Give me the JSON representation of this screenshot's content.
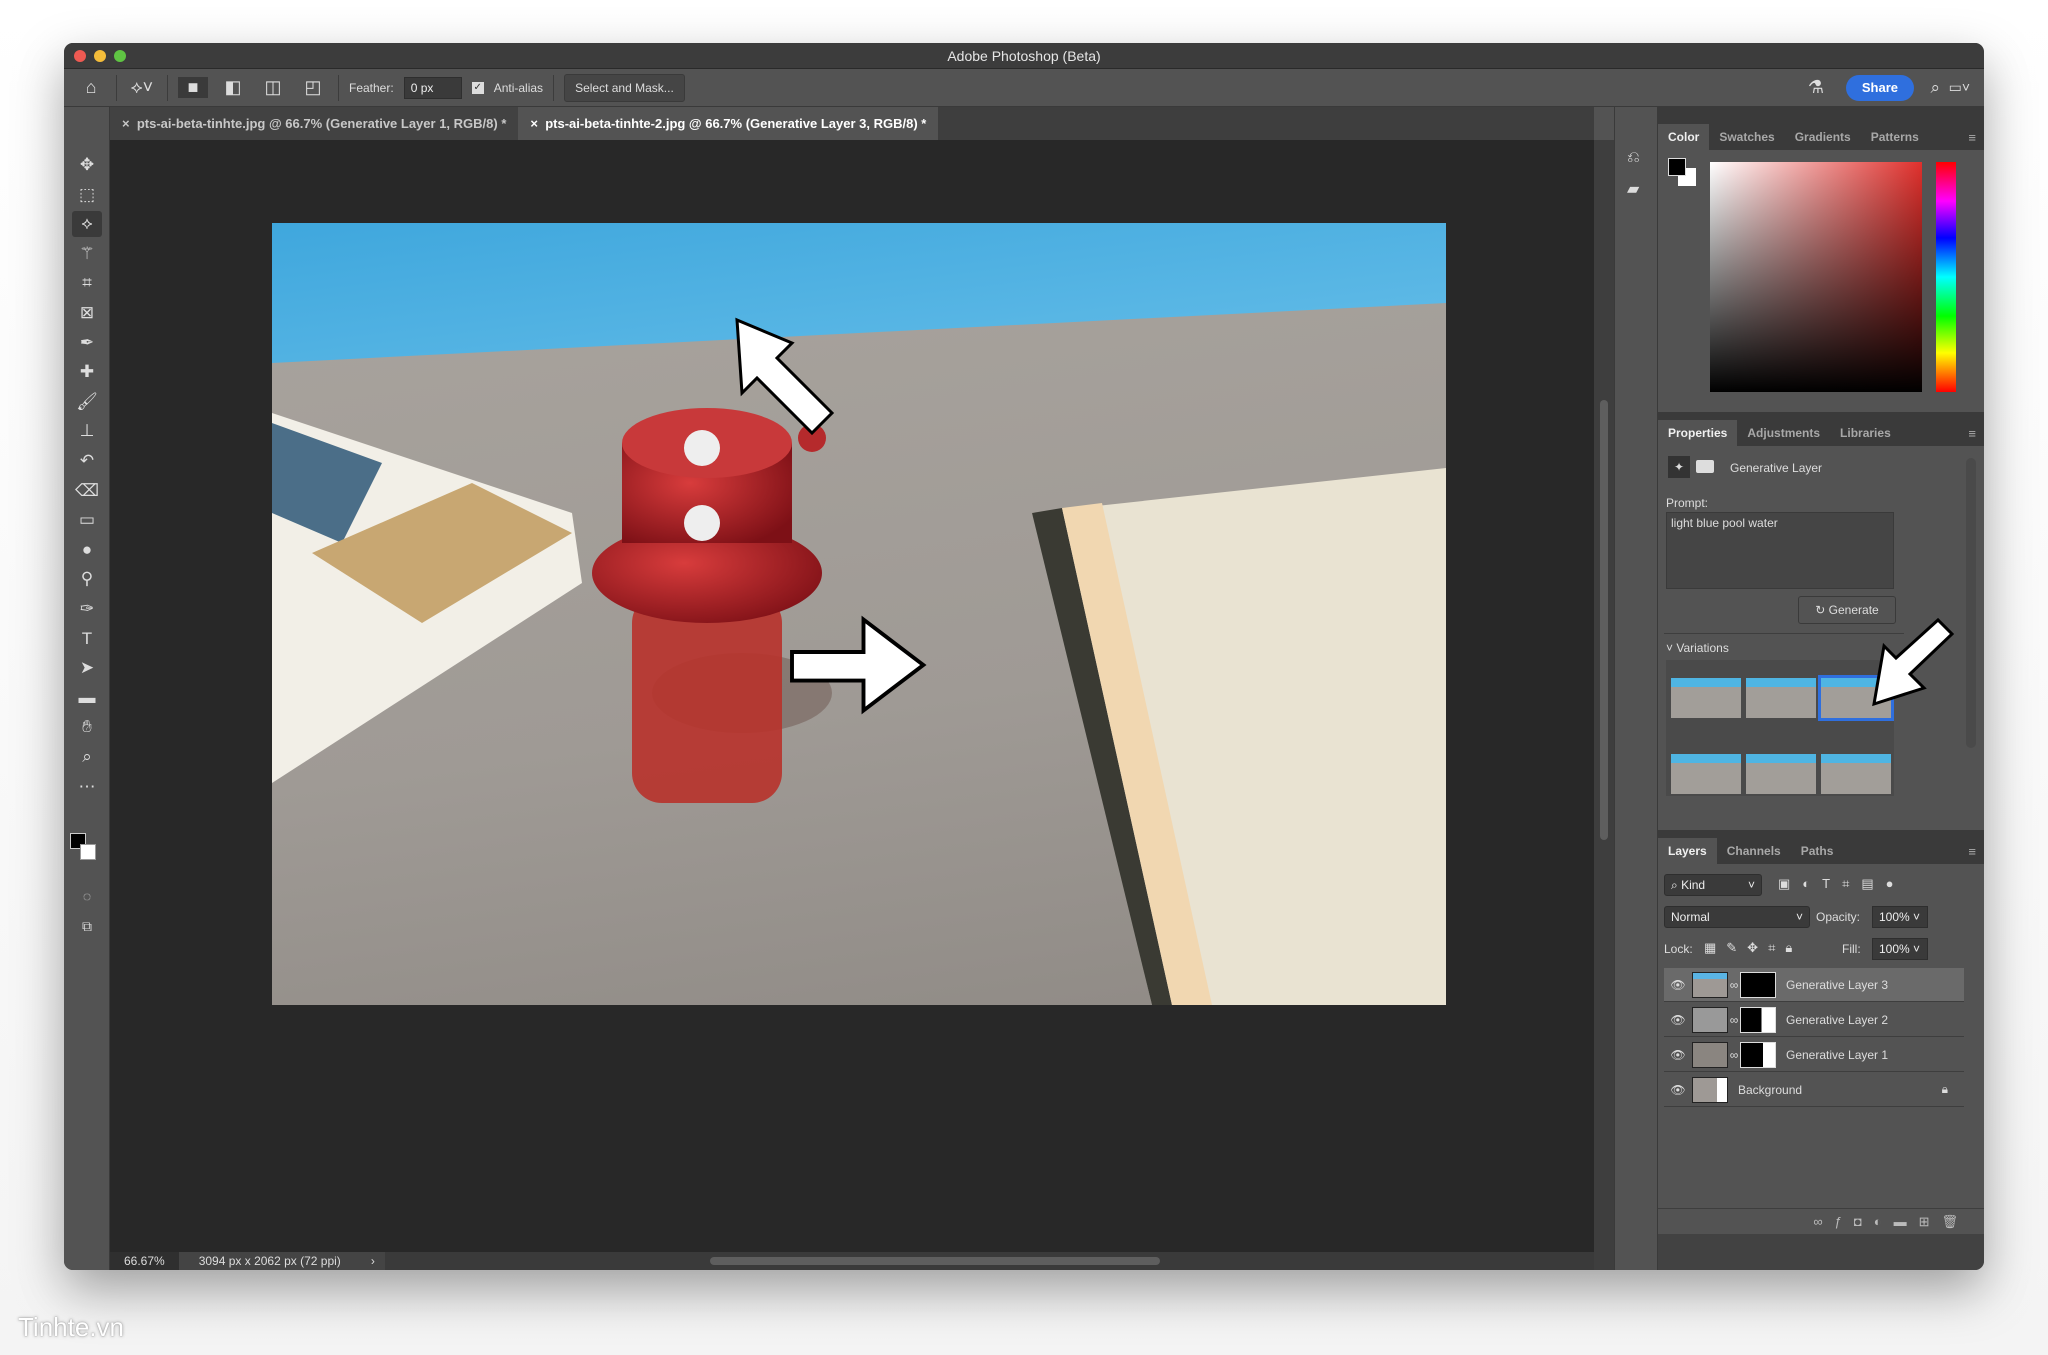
{
  "window": {
    "title": "Adobe Photoshop (Beta)"
  },
  "options": {
    "feather_label": "Feather:",
    "feather_value": "0 px",
    "antialias_label": "Anti-alias",
    "antialias_checked": true,
    "select_mask": "Select and Mask...",
    "share": "Share"
  },
  "tabs": [
    {
      "label": "pts-ai-beta-tinhte.jpg @ 66.7% (Generative Layer 1, RGB/8) *",
      "active": false
    },
    {
      "label": "pts-ai-beta-tinhte-2.jpg @ 66.7% (Generative Layer 3, RGB/8) *",
      "active": true
    }
  ],
  "tools": [
    "move",
    "marquee",
    "lasso",
    "magic-wand",
    "crop",
    "frame",
    "eyedropper",
    "healing",
    "brush",
    "stamp",
    "history-brush",
    "eraser",
    "gradient",
    "blur",
    "dodge",
    "pen",
    "type",
    "path-select",
    "rectangle",
    "hand",
    "zoom",
    "more"
  ],
  "status": {
    "zoom": "66.67%",
    "doc_info": "3094 px x 2062 px (72 ppi)"
  },
  "color_panel": {
    "tabs": [
      "Color",
      "Swatches",
      "Gradients",
      "Patterns"
    ],
    "hue": "#e0302c"
  },
  "properties": {
    "tabs": [
      "Properties",
      "Adjustments",
      "Libraries"
    ],
    "layer_type": "Generative Layer",
    "prompt_label": "Prompt:",
    "prompt": "light blue pool water",
    "generate": "Generate",
    "variations_label": "Variations",
    "variations_count": 6,
    "selected_variation": 3
  },
  "layers_panel": {
    "tabs": [
      "Layers",
      "Channels",
      "Paths"
    ],
    "filter": "Kind",
    "blend_mode": "Normal",
    "opacity_label": "Opacity:",
    "opacity": "100%",
    "lock_label": "Lock:",
    "fill_label": "Fill:",
    "fill": "100%",
    "layers": [
      {
        "name": "Generative Layer 3",
        "selected": true
      },
      {
        "name": "Generative Layer 2",
        "selected": false
      },
      {
        "name": "Generative Layer 1",
        "selected": false
      },
      {
        "name": "Background",
        "locked": true
      }
    ]
  },
  "watermark": "Tinhte.vn"
}
